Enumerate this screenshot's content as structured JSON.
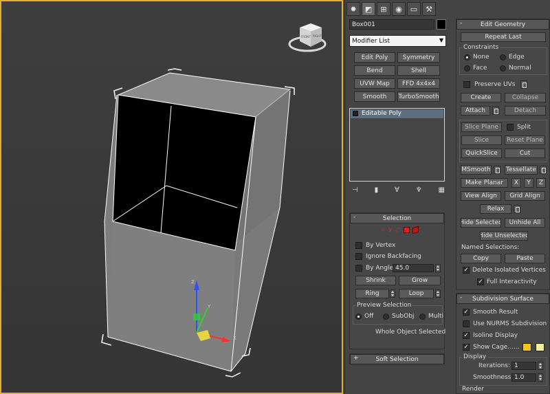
{
  "viewcube": {
    "faces": [
      "FRONT",
      "RIGHT"
    ]
  },
  "axes": {
    "x": "X",
    "y": "Y",
    "z": "Z"
  },
  "command_panel": {
    "tabs": [
      "create-icon",
      "modify-icon",
      "hierarchy-icon",
      "motion-icon",
      "display-icon",
      "utilities-icon"
    ],
    "object_name": "Box001",
    "object_color": "#000000",
    "modifier_list": "Modifier List",
    "modifier_buttons": [
      "Edit Poly",
      "Symmetry",
      "Bend",
      "Shell",
      "UVW Map",
      "FFD 4x4x4",
      "Smooth",
      "TurboSmooth"
    ],
    "stack_items": [
      "Editable Poly"
    ],
    "selection": {
      "title": "Selection",
      "by_vertex": "By Vertex",
      "ignore_backfacing": "Ignore Backfacing",
      "by_angle": "By Angle:",
      "angle_value": "45.0",
      "shrink": "Shrink",
      "grow": "Grow",
      "ring": "Ring",
      "loop": "Loop",
      "preview_title": "Preview Selection",
      "preview_off": "Off",
      "preview_subobj": "SubObj",
      "preview_multi": "Multi",
      "status": "Whole Object Selected"
    },
    "soft_selection": {
      "title": "Soft Selection"
    }
  },
  "edit_geometry": {
    "title": "Edit Geometry",
    "repeat_last": "Repeat Last",
    "constraints": "Constraints",
    "none": "None",
    "edge": "Edge",
    "face": "Face",
    "normal": "Normal",
    "preserve_uvs": "Preserve UVs",
    "create": "Create",
    "collapse": "Collapse",
    "attach": "Attach",
    "detach": "Detach",
    "slice_plane": "Slice Plane",
    "split": "Split",
    "slice": "Slice",
    "reset_plane": "Reset Plane",
    "quickslice": "QuickSlice",
    "cut": "Cut",
    "msmooth": "MSmooth",
    "tessellate": "Tessellate",
    "make_planar": "Make Planar",
    "x": "X",
    "y": "Y",
    "z": "Z",
    "view_align": "View Align",
    "grid_align": "Grid Align",
    "relax": "Relax",
    "hide_selected": "Hide Selected",
    "unhide_all": "Unhide All",
    "hide_unselected": "Hide Unselected",
    "named_selections": "Named Selections:",
    "copy": "Copy",
    "paste": "Paste",
    "delete_isolated": "Delete Isolated Vertices",
    "full_interactivity": "Full Interactivity"
  },
  "subdivision": {
    "title": "Subdivision Surface",
    "smooth_result": "Smooth Result",
    "use_nurms": "Use NURMS Subdivision",
    "isoline_display": "Isoline Display",
    "show_cage": "Show Cage......",
    "cage_color_1": "#f5c518",
    "cage_color_2": "#f3f0a0",
    "display": "Display",
    "iterations": "Iterations:",
    "iterations_value": "1",
    "smoothness": "Smoothness:",
    "smoothness_value": "1.0",
    "render": "Render"
  },
  "colors": {
    "viewport_border": "#e0b030",
    "panel_bg": "#444444"
  }
}
